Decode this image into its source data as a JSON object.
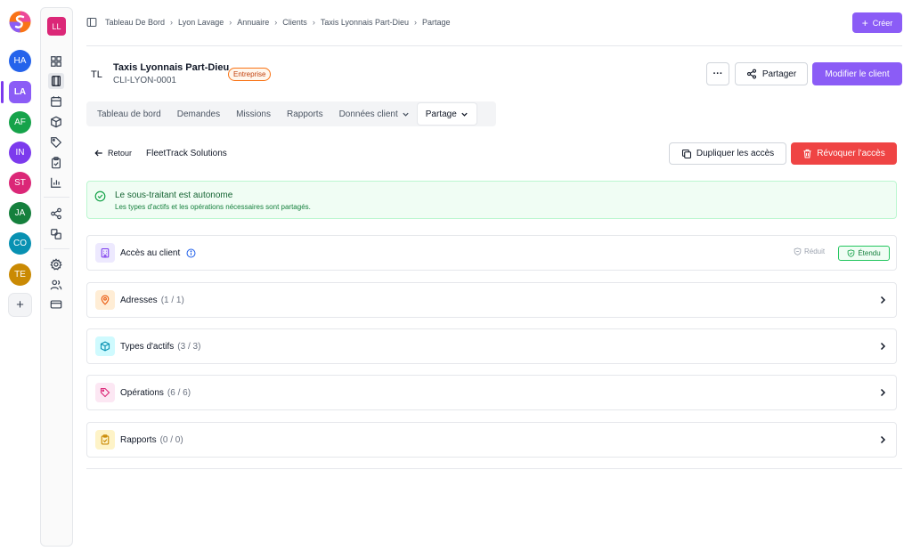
{
  "workspaces": [
    {
      "label": "HA",
      "color": "#2563eb"
    },
    {
      "label": "LA",
      "color": "#8b5cf6"
    },
    {
      "label": "AF",
      "color": "#16a34a"
    },
    {
      "label": "IN",
      "color": "#7c3aed"
    },
    {
      "label": "ST",
      "color": "#db2777"
    },
    {
      "label": "JA",
      "color": "#15803d"
    },
    {
      "label": "CO",
      "color": "#0891b2"
    },
    {
      "label": "TE",
      "color": "#ca8a04"
    }
  ],
  "add_workspace": "+",
  "org_badge": "LL",
  "breadcrumb": [
    "Tableau De Bord",
    "Lyon Lavage",
    "Annuaire",
    "Clients",
    "Taxis Lyonnais Part-Dieu",
    "Partage"
  ],
  "create_button": "Créer",
  "client": {
    "initials": "TL",
    "name": "Taxis Lyonnais Part-Dieu",
    "code": "CLI-LYON-0001",
    "badge": "Entreprise"
  },
  "header_actions": {
    "more": "···",
    "share": "Partager",
    "edit": "Modifier le client"
  },
  "tabs": [
    {
      "label": "Tableau de bord",
      "active": false
    },
    {
      "label": "Demandes",
      "active": false
    },
    {
      "label": "Missions",
      "active": false
    },
    {
      "label": "Rapports",
      "active": false
    },
    {
      "label": "Données client",
      "active": false
    },
    {
      "label": "Partage",
      "active": true
    }
  ],
  "share_view": {
    "back": "Retour",
    "partner": "FleetTrack Solutions",
    "duplicate": "Dupliquer les accès",
    "revoke": "Révoquer l'accès"
  },
  "alert": {
    "title": "Le sous-traitant est autonome",
    "description": "Les types d'actifs et les opérations nécessaires sont partagés."
  },
  "access": {
    "label": "Accès au client",
    "reduced": "Réduit",
    "extended": "Étendu"
  },
  "sections": [
    {
      "label": "Adresses",
      "count": "(1 / 1)",
      "icon": "map-pin-icon",
      "bg": "#ffedd5",
      "fg": "#ea580c"
    },
    {
      "label": "Types d'actifs",
      "count": "(3 / 3)",
      "icon": "cube-icon",
      "bg": "#cffafe",
      "fg": "#0891b2"
    },
    {
      "label": "Opérations",
      "count": "(6 / 6)",
      "icon": "tag-icon",
      "bg": "#fce7f3",
      "fg": "#db2777"
    },
    {
      "label": "Rapports",
      "count": "(0 / 0)",
      "icon": "clipboard-icon",
      "bg": "#fef3c7",
      "fg": "#ca8a04"
    }
  ]
}
